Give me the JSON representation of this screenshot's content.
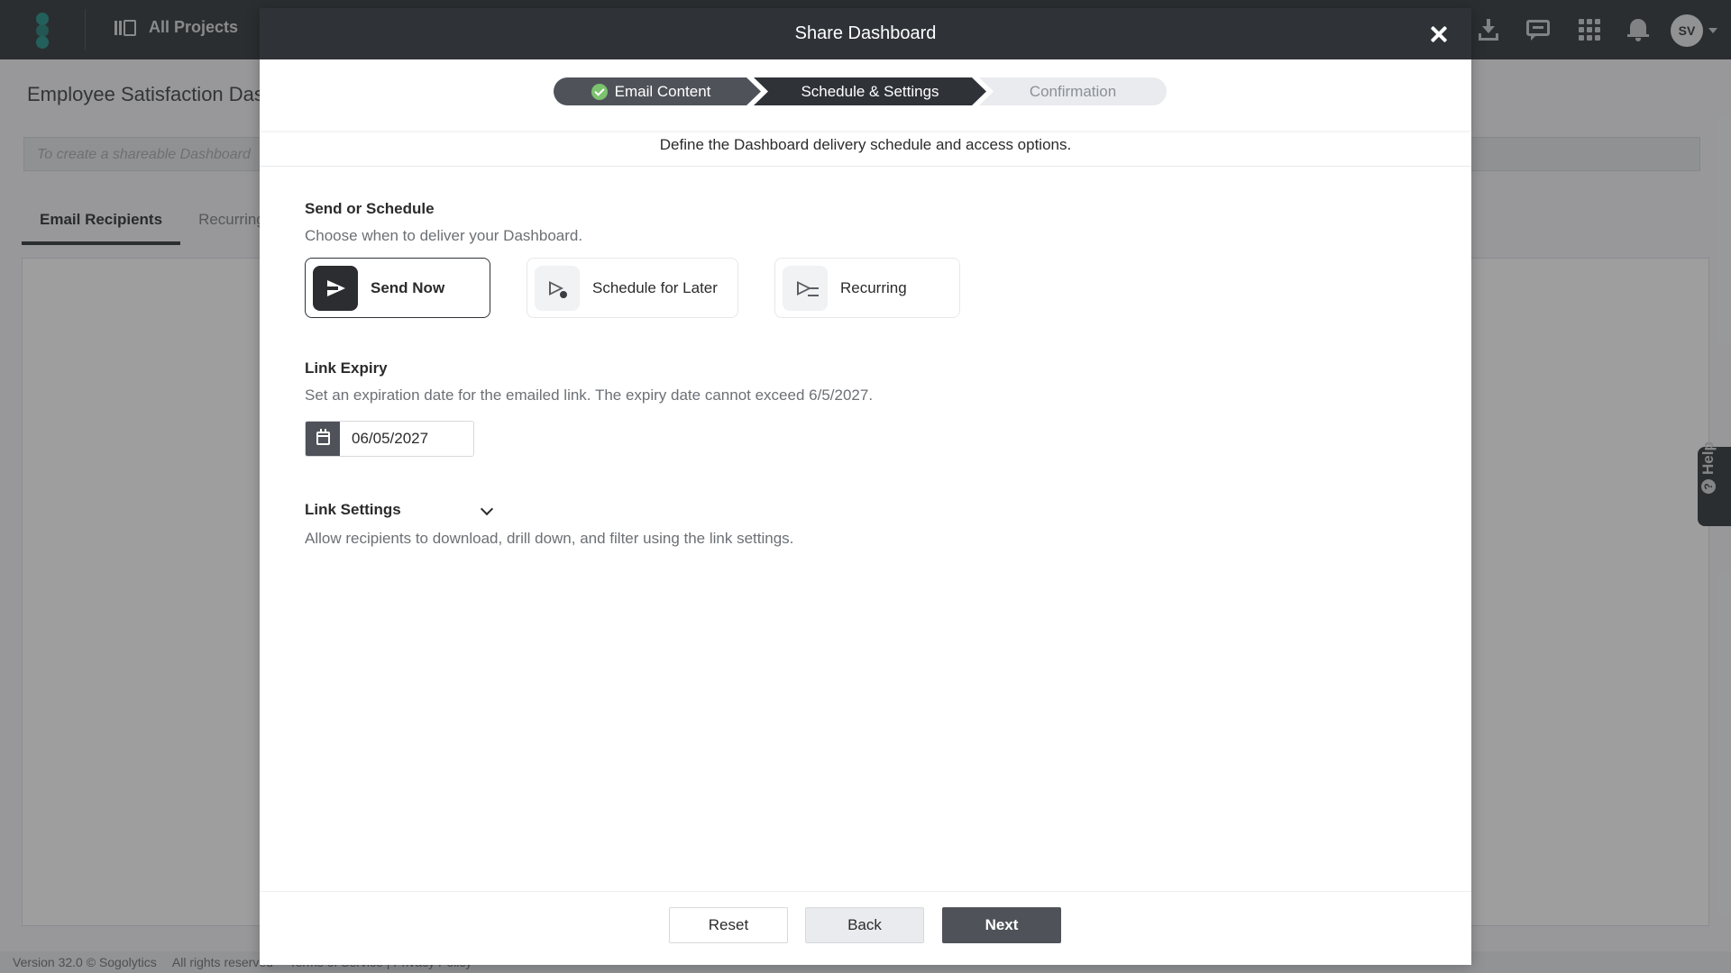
{
  "app": {
    "nav_label": "All Projects",
    "avatar_initials": "SV",
    "page_title": "Employee Satisfaction Dashboard",
    "share_placeholder": "To create a shareable Dashboard",
    "tabs": [
      {
        "label": "Email Recipients",
        "active": true
      },
      {
        "label": "Recurring",
        "active": false
      }
    ],
    "help_label": "Help",
    "footer": {
      "version": "Version 32.0 © Sogolytics",
      "rights": "All rights reserved",
      "links": "Terms of Service | Privacy Policy"
    }
  },
  "modal": {
    "title": "Share Dashboard",
    "steps": [
      {
        "label": "Email Content",
        "status": "completed"
      },
      {
        "label": "Schedule & Settings",
        "status": "current"
      },
      {
        "label": "Confirmation",
        "status": "upcoming"
      }
    ],
    "subtitle": "Define the Dashboard delivery schedule and access options.",
    "send_schedule": {
      "title": "Send or Schedule",
      "description": "Choose when to deliver your Dashboard.",
      "options": [
        {
          "label": "Send Now",
          "icon": "send-icon",
          "selected": true
        },
        {
          "label": "Schedule for Later",
          "icon": "send-clock-icon",
          "selected": false
        },
        {
          "label": "Recurring",
          "icon": "send-recurring-icon",
          "selected": false
        }
      ]
    },
    "link_expiry": {
      "title": "Link Expiry",
      "description": "Set an expiration date for the emailed link. The expiry date cannot exceed 6/5/2027.",
      "date_value": "06/05/2027"
    },
    "link_settings": {
      "title": "Link Settings",
      "description": "Allow recipients to download, drill down, and filter using the link settings."
    },
    "buttons": {
      "reset": "Reset",
      "back": "Back",
      "next": "Next"
    }
  },
  "colors": {
    "header_dark": "#2f3338",
    "step_done": "#4f5359",
    "check_green": "#7cc26f",
    "next_button": "#4f5359"
  }
}
